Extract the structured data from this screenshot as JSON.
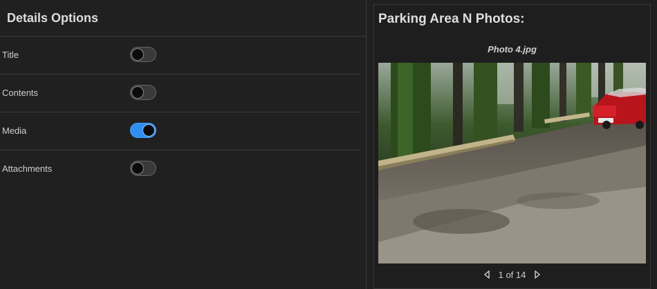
{
  "details": {
    "title": "Details Options",
    "options": [
      {
        "label": "Title",
        "enabled": false
      },
      {
        "label": "Contents",
        "enabled": false
      },
      {
        "label": "Media",
        "enabled": true
      },
      {
        "label": "Attachments",
        "enabled": false
      }
    ]
  },
  "popup": {
    "title": "Parking Area N Photos:",
    "caption": "Photo 4.jpg",
    "pager": {
      "text": "1 of 14"
    }
  },
  "colors": {
    "toggle_on": "#2f8ef0",
    "background": "#202020"
  },
  "icons": {
    "prev": "chevron-left-icon",
    "next": "chevron-right-icon"
  }
}
